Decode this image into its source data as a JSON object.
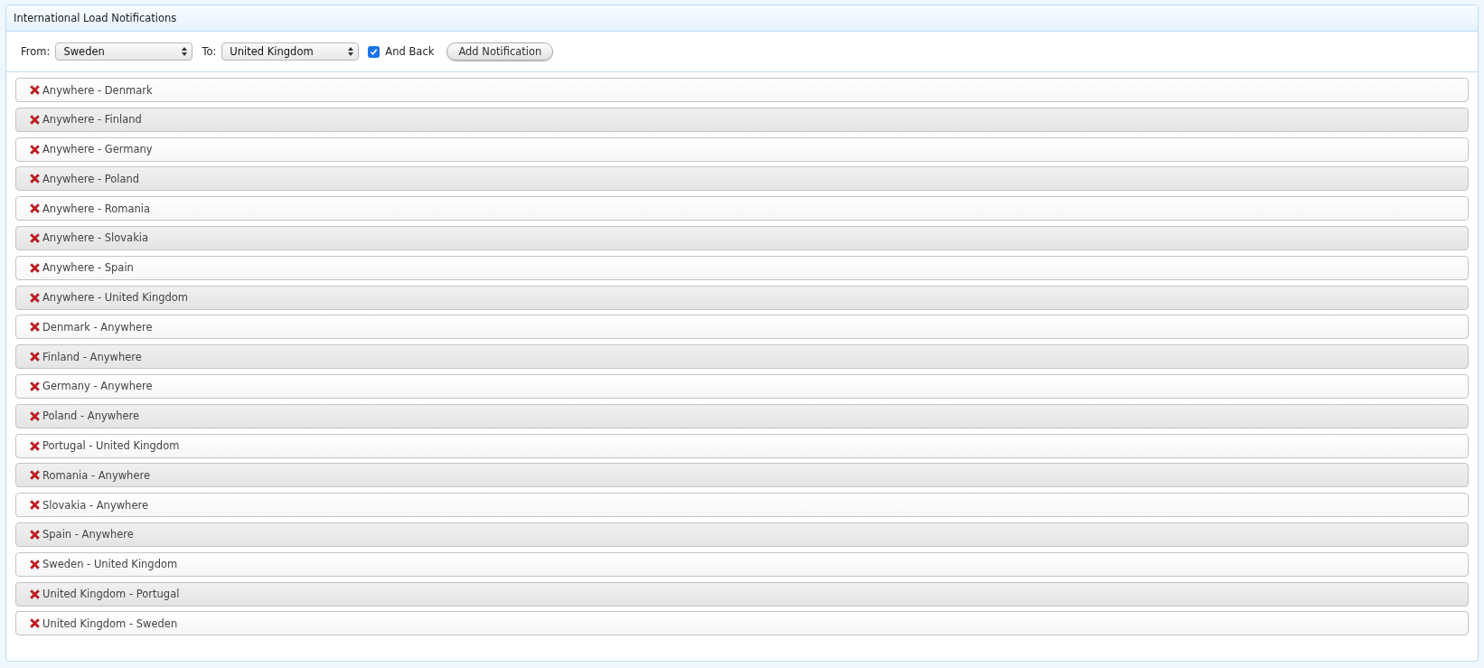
{
  "panel": {
    "title": "International Load Notifications"
  },
  "form": {
    "from_label": "From:",
    "from_value": "Sweden",
    "to_label": "To:",
    "to_value": "United Kingdom",
    "and_back": {
      "label": "And Back",
      "checked": true
    },
    "add_button": "Add Notification"
  },
  "notifications": [
    {
      "label": "Anywhere - Denmark"
    },
    {
      "label": "Anywhere - Finland"
    },
    {
      "label": "Anywhere - Germany"
    },
    {
      "label": "Anywhere - Poland"
    },
    {
      "label": "Anywhere - Romania"
    },
    {
      "label": "Anywhere - Slovakia"
    },
    {
      "label": "Anywhere - Spain"
    },
    {
      "label": "Anywhere - United Kingdom"
    },
    {
      "label": "Denmark - Anywhere"
    },
    {
      "label": "Finland - Anywhere"
    },
    {
      "label": "Germany - Anywhere"
    },
    {
      "label": "Poland - Anywhere"
    },
    {
      "label": "Portugal - United Kingdom"
    },
    {
      "label": "Romania - Anywhere"
    },
    {
      "label": "Slovakia - Anywhere"
    },
    {
      "label": "Spain - Anywhere"
    },
    {
      "label": "Sweden - United Kingdom"
    },
    {
      "label": "United Kingdom - Portugal"
    },
    {
      "label": "United Kingdom - Sweden"
    }
  ]
}
